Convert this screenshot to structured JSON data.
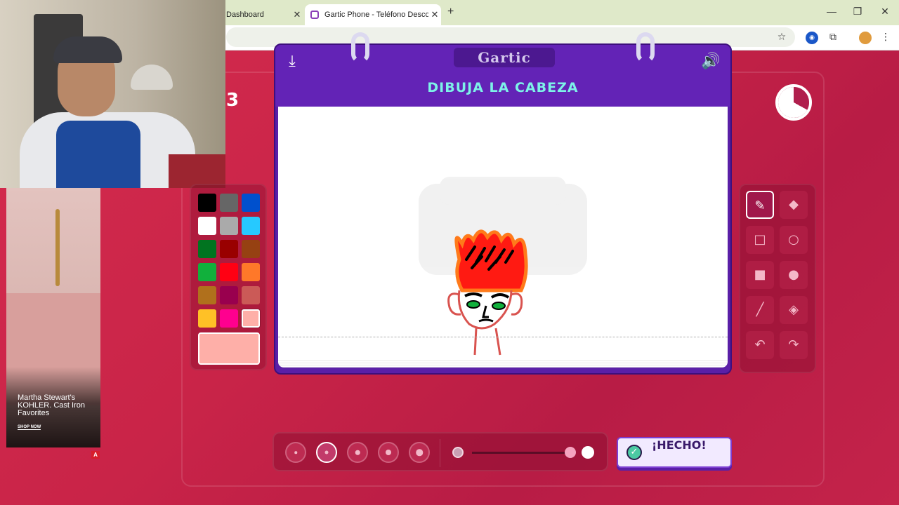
{
  "browser": {
    "tabs": [
      {
        "title": "Dashboard",
        "active": false
      },
      {
        "title": "Gartic Phone - Teléfono Descon",
        "active": true
      }
    ],
    "new_tab_label": "+",
    "close_glyph": "✕",
    "window_controls": [
      "—",
      "❐",
      "✕"
    ],
    "toolbar_icons": [
      "star-icon",
      "extension-badge-icon",
      "puzzle-icon",
      "profile-avatar",
      "menu-icon"
    ]
  },
  "overlay": {
    "ad": {
      "text": "Martha Stewart's KOHLER. Cast Iron Favorites",
      "cta": "SHOP NOW",
      "badge": "A"
    }
  },
  "game": {
    "round_number": "3",
    "logo": "Gartic",
    "prompt": "DIBUJA LA CABEZA",
    "timer_remaining_fraction": 0.67,
    "done_label": "¡HECHO!",
    "palette": {
      "colors": [
        "#000000",
        "#666666",
        "#0050cd",
        "#ffffff",
        "#aaaaaa",
        "#26c9ff",
        "#017420",
        "#990000",
        "#964112",
        "#11b03c",
        "#ff0013",
        "#ff7829",
        "#b0701c",
        "#99004e",
        "#cb5a57",
        "#ffc126",
        "#ff008f",
        "#feafa8"
      ],
      "selected_index": 17,
      "current_color": "#feafa8"
    },
    "tools": [
      {
        "name": "pencil",
        "glyph": "✎",
        "active": true
      },
      {
        "name": "eraser",
        "glyph": "◆",
        "active": false
      },
      {
        "name": "rectangle-outline",
        "glyph": "□",
        "active": false
      },
      {
        "name": "ellipse-outline",
        "glyph": "○",
        "active": false
      },
      {
        "name": "rectangle-filled",
        "glyph": "■",
        "active": false
      },
      {
        "name": "ellipse-filled",
        "glyph": "●",
        "active": false
      },
      {
        "name": "line",
        "glyph": "╱",
        "active": false
      },
      {
        "name": "fill-bucket",
        "glyph": "◈",
        "active": false
      },
      {
        "name": "undo",
        "glyph": "↶",
        "active": false
      },
      {
        "name": "redo",
        "glyph": "↷",
        "active": false
      }
    ],
    "brush_sizes": [
      {
        "level": 1,
        "active": false
      },
      {
        "level": 2,
        "active": true
      },
      {
        "level": 3,
        "active": false
      },
      {
        "level": 4,
        "active": false
      },
      {
        "level": 5,
        "active": false
      }
    ],
    "opacity_fraction": 1.0
  }
}
